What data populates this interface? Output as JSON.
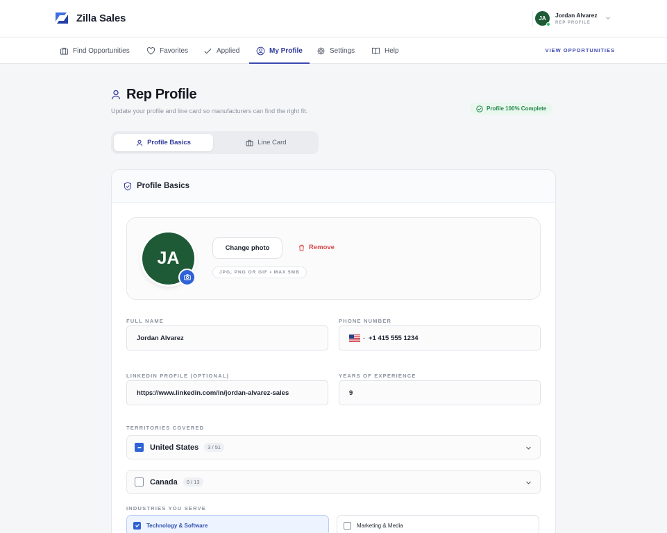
{
  "app": {
    "name": "Zilla Sales"
  },
  "user": {
    "name": "Jordan Alvarez",
    "role": "REP PROFILE",
    "initials": "JA"
  },
  "nav": {
    "items": [
      {
        "label": "Find Opportunities",
        "icon": "briefcase-icon"
      },
      {
        "label": "Favorites",
        "icon": "heart-icon"
      },
      {
        "label": "Applied",
        "icon": "check-icon"
      },
      {
        "label": "My Profile",
        "icon": "user-circle-icon",
        "active": true
      },
      {
        "label": "Settings",
        "icon": "gear-icon"
      },
      {
        "label": "Help",
        "icon": "book-icon"
      }
    ],
    "cta": "VIEW OPPORTUNITIES"
  },
  "page": {
    "title": "Rep Profile",
    "subtitle": "Update your profile and line card so manufacturers can find the right fit.",
    "badge": "Profile 100% Complete"
  },
  "tabs": [
    {
      "label": "Profile Basics",
      "active": true
    },
    {
      "label": "Line Card",
      "active": false
    }
  ],
  "card": {
    "title": "Profile Basics",
    "photo": {
      "initials": "JA",
      "change_label": "Change photo",
      "remove_label": "Remove",
      "hint": "JPG, PNG OR GIF • MAX 5MB"
    },
    "fields": {
      "full_name": {
        "label": "FULL NAME",
        "value": "Jordan Alvarez"
      },
      "phone": {
        "label": "PHONE NUMBER",
        "value": "+1 415 555 1234",
        "dash": "-"
      },
      "linkedin": {
        "label": "LINKEDIN PROFILE (OPTIONAL)",
        "value": "https://www.linkedin.com/in/jordan-alvarez-sales"
      },
      "experience": {
        "label": "YEARS OF EXPERIENCE",
        "value": "9"
      }
    },
    "territories": {
      "label": "TERRITORIES COVERED",
      "items": [
        {
          "name": "United States",
          "count": "3 / 51",
          "state": "partial"
        },
        {
          "name": "Canada",
          "count": "0 / 13",
          "state": "empty"
        }
      ]
    },
    "industries": {
      "label": "INDUSTRIES YOU SERVE",
      "items": [
        {
          "name": "Technology & Software",
          "checked": true
        },
        {
          "name": "Marketing & Media",
          "checked": false
        }
      ]
    }
  },
  "colors": {
    "accent": "#2f62d6",
    "nav_active": "#3b46b0",
    "avatar": "#1f5a37",
    "success": "#23864b",
    "danger": "#d94848"
  }
}
